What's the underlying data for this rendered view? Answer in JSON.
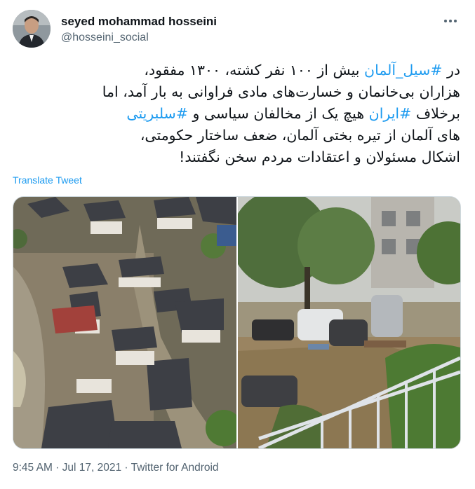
{
  "user": {
    "display_name": "seyed mohammad hosseini",
    "handle": "@hosseini_social"
  },
  "tweet": {
    "lines": [
      [
        {
          "t": "در ",
          "tag": false
        },
        {
          "t": "#سیل_آلمان",
          "tag": true
        },
        {
          "t": " بیش از ۱۰۰ نفر کشته، ۱۳۰۰ مفقود،",
          "tag": false
        }
      ],
      [
        {
          "t": "هزاران بی‌خانمان و خسارت‌های مادی فراوانی به بار آمد، اما",
          "tag": false
        }
      ],
      [
        {
          "t": "برخلاف ",
          "tag": false
        },
        {
          "t": "#ایران",
          "tag": true
        },
        {
          "t": " هیچ یک از مخالفان سیاسی و ",
          "tag": false
        },
        {
          "t": "#سلبریتی",
          "tag": true
        }
      ],
      [
        {
          "t": "های آلمان از تیره بختی آلمان، ضعف ساختار حکومتی،",
          "tag": false
        }
      ],
      [
        {
          "t": "اشکال مسئولان و اعتقادات مردم سخن نگفتند!",
          "tag": false
        }
      ]
    ],
    "translate_label": "Translate Tweet"
  },
  "media": {
    "icons": {
      "left": "flood-aerial-photo",
      "right": "flooded-street-photo"
    }
  },
  "meta": {
    "time": "9:45 AM",
    "sep": " · ",
    "date": "Jul 17, 2021",
    "source": "Twitter for Android"
  },
  "colors": {
    "accent": "#1d9bf0",
    "text": "#0f1419",
    "secondary": "#536471"
  }
}
